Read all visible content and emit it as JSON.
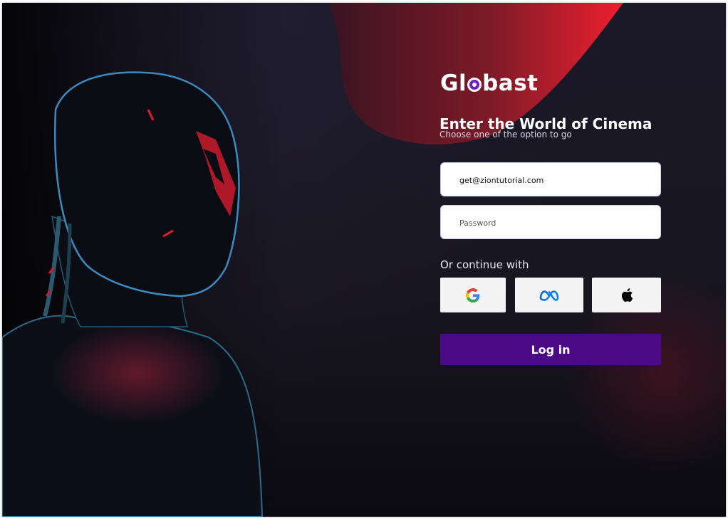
{
  "brand": {
    "logo_prefix": "Gl",
    "logo_suffix": "bast",
    "accent_color": "#e51b2b",
    "button_color": "#4a0a86"
  },
  "hero": {
    "image": "armored-hero-silhouette"
  },
  "form": {
    "heading": "Enter the World of Cinema",
    "subheading": "Choose one of the option to go",
    "email_value": "get@ziontutorial.com",
    "password_placeholder": "Password",
    "continue_label": "Or continue with",
    "social": [
      {
        "name": "Google",
        "icon": "google-icon"
      },
      {
        "name": "Meta",
        "icon": "meta-icon"
      },
      {
        "name": "Apple",
        "icon": "apple-icon"
      }
    ],
    "login_label": "Log in"
  }
}
